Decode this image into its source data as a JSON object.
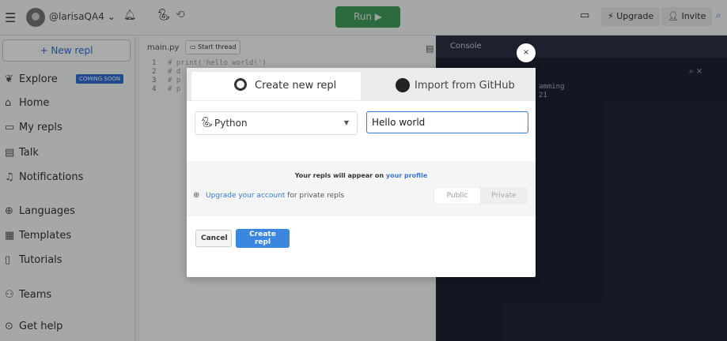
{
  "topbar": {
    "username": "@larisaQA4",
    "user_chevron": "⌄",
    "run_label": "Run ▶",
    "upgrade_label": "Upgrade",
    "invite_label": "Invite",
    "icons": [
      "menu-icon",
      "avatar",
      "bell-icon",
      "python-icon",
      "history-icon",
      "chat-icon",
      "search-icon"
    ]
  },
  "sidebar": {
    "new_repl_label": "+ New repl",
    "items": [
      {
        "label": "Explore",
        "badge": "COMING SOON",
        "icon": "explore-icon"
      },
      {
        "label": "Home",
        "icon": "home-icon"
      },
      {
        "label": "My repls",
        "icon": "folder-icon"
      },
      {
        "label": "Talk",
        "icon": "talk-icon"
      },
      {
        "label": "Notifications",
        "icon": "bell-icon"
      },
      {
        "label": "Languages",
        "icon": "globe-icon"
      },
      {
        "label": "Templates",
        "icon": "templates-icon"
      },
      {
        "label": "Tutorials",
        "icon": "book-icon"
      },
      {
        "label": "Teams",
        "icon": "teams-icon"
      },
      {
        "label": "Get help",
        "icon": "help-icon"
      }
    ]
  },
  "editor": {
    "filename": "main.py",
    "thread_label": "Start thread",
    "lines": [
      {
        "n": "1",
        "text": "# print('hello world!')"
      },
      {
        "n": "2",
        "text": "# d"
      },
      {
        "n": "3",
        "text": "# p"
      },
      {
        "n": "4",
        "text": "# p"
      }
    ]
  },
  "console": {
    "tab_label": "Console",
    "output": [
      "amming",
      "21"
    ]
  },
  "modal": {
    "tab_create_label": "Create new repl",
    "tab_import_label": "Import from GitHub",
    "language": "Python",
    "name_value": "Hello world",
    "appear_text": "Your repls will appear on",
    "profile_link": "your profile",
    "upgrade_link": "Upgrade your account",
    "upgrade_suffix": "for private repls",
    "public_label": "Public",
    "private_label": "Private",
    "cancel_label": "Cancel",
    "create_label": "Create repl",
    "close_glyph": "×"
  },
  "colors": {
    "accent": "#3b87e0",
    "run_green": "#3f9c5a",
    "console_bg": "#1c2333"
  }
}
